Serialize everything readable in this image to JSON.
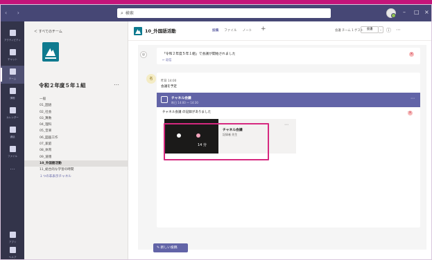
{
  "titlebar": {
    "search_placeholder": "検索",
    "window_controls": [
      "–",
      "□",
      "×"
    ]
  },
  "rail": {
    "items": [
      {
        "label": "アクティビティ",
        "icon": "bell-icon"
      },
      {
        "label": "チャット",
        "icon": "chat-icon"
      },
      {
        "label": "チーム",
        "icon": "teams-icon"
      },
      {
        "label": "課題",
        "icon": "backpack-icon"
      },
      {
        "label": "カレンダー",
        "icon": "calendar-icon"
      },
      {
        "label": "通話",
        "icon": "phone-icon"
      },
      {
        "label": "ファイル",
        "icon": "file-icon"
      },
      {
        "label": "…",
        "icon": "more-icon"
      },
      {
        "label": "アプリ",
        "icon": "apps-icon"
      },
      {
        "label": "ヘルプ",
        "icon": "help-icon"
      }
    ]
  },
  "left_panel": {
    "back_label": "＜ すべてのチーム",
    "team_name": "令和２年度５年１組",
    "team_more": "…",
    "channels": [
      "一般",
      "01_国語",
      "02_社会",
      "03_算数",
      "04_理科",
      "05_音楽",
      "06_図画工作",
      "07_家庭",
      "08_体育",
      "09_道徳",
      "10_外国語活動",
      "11_総合的な学習の時間",
      "１つの非表示チャネル"
    ],
    "active_channel_index": 10
  },
  "main": {
    "channel_title": "10_外国語活動",
    "tabs": [
      "投稿",
      "ファイル",
      "ノート"
    ],
    "active_tab_index": 0,
    "tab_add": "+",
    "header_right": "会議 チーム 1 ゲスト",
    "meet_button": "会議",
    "meet_dropdown": "⌄",
    "info_icon": "ⓘ",
    "more_icon": "⋯",
    "system_message": {
      "text": "「令和２年度５年１組」で会議が開始されました",
      "reply": "← 返信"
    },
    "post": {
      "avatar": "名",
      "meta": "昨日 14:00",
      "body": "会議を予定",
      "meeting_title": "チャネル会議",
      "meeting_time": "昨日 14:00 ～ 14:30",
      "meeting_more": "⋯",
      "recording_line": "チャネル会議 の記録がありました",
      "recording_line_dash": "–",
      "recording_title": "チャネル会議",
      "recording_sub": "記録者 先生",
      "recording_duration": "14 分",
      "recording_more": "⋯"
    },
    "new_conversation_label": "新しい投稿",
    "close_glyph": "×"
  },
  "colors": {
    "titlebar": "#464775",
    "rail": "#33344a",
    "accent": "#6264a7",
    "highlight": "#d6287f",
    "top_accent": "#c4147a"
  }
}
